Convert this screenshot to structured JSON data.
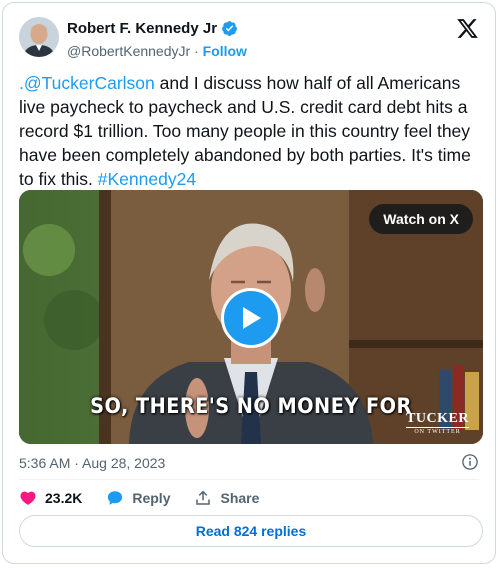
{
  "author": {
    "name": "Robert F. Kennedy Jr",
    "handle": "@RobertKennedyJr",
    "separator": "·",
    "follow_label": "Follow",
    "verified_color": "#1d9bf0"
  },
  "icons": {
    "logo": "x-logo-icon",
    "verified": "verified-badge-icon",
    "info": "info-icon",
    "like": "heart-icon",
    "reply": "reply-bubble-icon",
    "share": "share-upload-icon",
    "play": "play-icon"
  },
  "tweet": {
    "mention": ".@TuckerCarlson",
    "body": " and I discuss how half of all Americans live paycheck to paycheck and U.S. credit card debt hits a record $1 trillion. Too many people in this country feel they have been completely abandoned by both parties. It's time to fix this. ",
    "hashtag": "#Kennedy24"
  },
  "media": {
    "watch_label": "Watch on X",
    "caption": "SO, THERE'S NO MONEY FOR",
    "watermark_main": "TUCKER",
    "watermark_sub": "ON TWITTER"
  },
  "meta": {
    "timestamp": "5:36 AM · Aug 28, 2023"
  },
  "actions": {
    "likes": "23.2K",
    "reply_label": "Reply",
    "share_label": "Share"
  },
  "footer": {
    "read_replies": "Read 824 replies"
  },
  "colors": {
    "accent": "#1d9bf0",
    "like": "#f91880",
    "muted": "#536471",
    "border": "#cfd9de"
  }
}
